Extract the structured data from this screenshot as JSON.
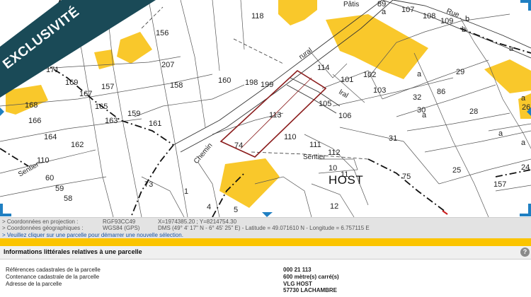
{
  "banner": {
    "text": "EXCLUSIVITÉ",
    "color": "#1a4a57"
  },
  "colors": {
    "building": "#f9c82b",
    "selected_parcel": "#8b1d1d",
    "coords_bg": "#e3e3e3",
    "accent_bar": "#fbc400",
    "corner_marker": "#1f7fc2"
  },
  "map": {
    "village": "HOST",
    "streets": [
      "Chemin",
      "Sentier",
      "Rue",
      "Pâtis"
    ],
    "street_fragments": [
      "rural",
      "lral"
    ],
    "parcels": [
      "118",
      "156",
      "207",
      "171",
      "169",
      "167",
      "157",
      "168",
      "165",
      "166",
      "163",
      "164",
      "162",
      "110",
      "60",
      "59",
      "58",
      "73",
      "1",
      "4",
      "5",
      "160",
      "198",
      "199",
      "158",
      "161",
      "159",
      "114",
      "101",
      "102",
      "103",
      "113",
      "105",
      "106",
      "107",
      "108",
      "109",
      "89",
      "29",
      "86",
      "32",
      "30",
      "28",
      "31",
      "25",
      "74",
      "110",
      "111",
      "112",
      "10",
      "11",
      "12",
      "75",
      "157",
      "24",
      "26",
      "a",
      "a",
      "a",
      "a",
      "b",
      "b",
      "c",
      "a",
      "a",
      "a",
      "a",
      "a",
      "a",
      "a"
    ],
    "labels": [
      {
        "text": "118",
        "name": "parcel-118"
      },
      {
        "text": "156",
        "name": "parcel-156"
      },
      {
        "text": "207",
        "name": "parcel-207"
      },
      {
        "text": "171",
        "name": "parcel-171"
      },
      {
        "text": "169",
        "name": "parcel-169"
      },
      {
        "text": "167",
        "name": "parcel-167"
      },
      {
        "text": "157",
        "name": "parcel-157-west"
      },
      {
        "text": "168",
        "name": "parcel-168"
      },
      {
        "text": "165",
        "name": "parcel-165"
      },
      {
        "text": "166",
        "name": "parcel-166"
      },
      {
        "text": "163",
        "name": "parcel-163"
      },
      {
        "text": "164",
        "name": "parcel-164"
      },
      {
        "text": "162",
        "name": "parcel-162"
      },
      {
        "text": "110",
        "name": "parcel-110-west"
      },
      {
        "text": "60",
        "name": "parcel-60"
      },
      {
        "text": "59",
        "name": "parcel-59"
      },
      {
        "text": "58",
        "name": "parcel-58"
      },
      {
        "text": "73",
        "name": "parcel-73"
      },
      {
        "text": "1",
        "name": "parcel-1"
      },
      {
        "text": "4",
        "name": "parcel-4"
      },
      {
        "text": "5",
        "name": "parcel-5"
      },
      {
        "text": "160",
        "name": "parcel-160"
      },
      {
        "text": "198",
        "name": "parcel-198"
      },
      {
        "text": "199",
        "name": "parcel-199"
      },
      {
        "text": "158",
        "name": "parcel-158"
      },
      {
        "text": "161",
        "name": "parcel-161"
      },
      {
        "text": "159",
        "name": "parcel-159"
      },
      {
        "text": "114",
        "name": "parcel-114"
      },
      {
        "text": "101",
        "name": "parcel-101"
      },
      {
        "text": "102",
        "name": "parcel-102"
      },
      {
        "text": "103",
        "name": "parcel-103"
      },
      {
        "text": "113",
        "name": "parcel-113"
      },
      {
        "text": "105",
        "name": "parcel-105"
      },
      {
        "text": "106",
        "name": "parcel-106"
      },
      {
        "text": "107",
        "name": "parcel-107"
      },
      {
        "text": "108",
        "name": "parcel-108"
      },
      {
        "text": "109",
        "name": "parcel-109"
      },
      {
        "text": "89",
        "name": "parcel-89"
      },
      {
        "text": "29",
        "name": "parcel-29"
      },
      {
        "text": "86",
        "name": "parcel-86"
      },
      {
        "text": "32",
        "name": "parcel-32"
      },
      {
        "text": "30",
        "name": "parcel-30"
      },
      {
        "text": "28",
        "name": "parcel-28"
      },
      {
        "text": "31",
        "name": "parcel-31"
      },
      {
        "text": "25",
        "name": "parcel-25"
      },
      {
        "text": "74",
        "name": "parcel-74"
      },
      {
        "text": "110",
        "name": "parcel-110"
      },
      {
        "text": "111",
        "name": "parcel-111"
      },
      {
        "text": "112",
        "name": "parcel-112"
      },
      {
        "text": "10",
        "name": "parcel-10"
      },
      {
        "text": "11",
        "name": "parcel-11"
      },
      {
        "text": "12",
        "name": "parcel-12"
      },
      {
        "text": "75",
        "name": "parcel-75"
      },
      {
        "text": "157",
        "name": "parcel-157-east"
      },
      {
        "text": "24",
        "name": "parcel-24"
      },
      {
        "text": "26",
        "name": "parcel-26"
      },
      {
        "text": "a",
        "name": "section-a-1"
      },
      {
        "text": "a",
        "name": "section-a-2"
      },
      {
        "text": "a",
        "name": "section-a-3"
      },
      {
        "text": "a",
        "name": "section-a-4"
      },
      {
        "text": "b",
        "name": "section-b-1"
      },
      {
        "text": "b",
        "name": "section-b-2"
      },
      {
        "text": "c",
        "name": "section-c"
      },
      {
        "text": "a",
        "name": "section-a-5"
      },
      {
        "text": "a",
        "name": "section-a-6"
      },
      {
        "text": "a",
        "name": "section-a-7"
      }
    ]
  },
  "coordinates": {
    "projection_label": "> Coordonnées en projection :",
    "projection_system": "RGF93CC49",
    "projection_value": "X=1974385.20 ; Y=8214754.30",
    "geo_label": "> Coordonnées géographiques :",
    "geo_system": "WGS84 (GPS)",
    "geo_value": "DMS (49° 4' 17\" N - 6° 45' 25\" E) - Latitude = 49.071610 N - Longitude = 6.757115 E",
    "new_selection_link": "> Veuillez cliquer sur une parcelle pour démarrer une nouvelle sélection."
  },
  "info": {
    "title": "Informations littérales relatives à une parcelle",
    "help": "?",
    "rows": [
      {
        "label": "Références cadastrales de la parcelle",
        "value": "000 21 113"
      },
      {
        "label": "Contenance cadastrale de la parcelle",
        "value": "600 mètre(s) carré(s)"
      },
      {
        "label": "Adresse de la parcelle",
        "value": "VLG HOST"
      },
      {
        "label": "",
        "value": "57730 LACHAMBRE"
      }
    ]
  }
}
